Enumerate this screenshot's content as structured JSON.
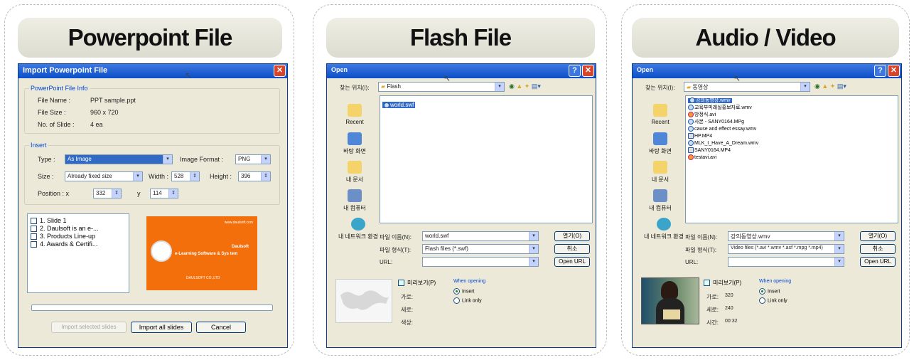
{
  "panels": {
    "ppt": {
      "title": "Powerpoint File"
    },
    "flash": {
      "title": "Flash File"
    },
    "av": {
      "title": "Audio / Video"
    }
  },
  "ppt_dialog": {
    "title": "Import Powerpoint File",
    "info_group": "PowerPoint File Info",
    "file_name_label": "File Name :",
    "file_name": "PPT sample.ppt",
    "file_size_label": "File Size :",
    "file_size": "960 x 720",
    "slides_label": "No. of Slide :",
    "slides": "4 ea",
    "insert_group": "Insert",
    "type_label": "Type :",
    "type_value": "As Image",
    "format_label": "Image Format :",
    "format_value": "PNG",
    "size_label": "Size :",
    "size_value": "Already fixed size",
    "width_label": "Width :",
    "width_value": "528",
    "height_label": "Height :",
    "height_value": "396",
    "position_label": "Position : x",
    "pos_x": "332",
    "y_label": "y",
    "pos_y": "114",
    "slides_list": [
      "1. Slide 1",
      "2. Daulsoft is an e-...",
      "3. Products Line-up",
      "4. Awards & Certifi..."
    ],
    "preview": {
      "brand": "Daulsoft",
      "line1": "e-Learning Software & Sys tem",
      "tag": "DAULSOFT CO.,LTD",
      "small": "www.daulsoft.com"
    },
    "btn_import_selected": "Import selected slides",
    "btn_import_all": "Import all slides",
    "btn_cancel": "Cancel"
  },
  "flash_dialog": {
    "title": "Open",
    "lookin_label": "찾는 위치(I):",
    "lookin_value": "Flash",
    "places": [
      "Recent",
      "바탕 화면",
      "내 문서",
      "내 컴퓨터",
      "내 네트워크 환경"
    ],
    "files": [
      "world.swf"
    ],
    "filename_label": "파일 이름(N):",
    "filename_value": "world.swf",
    "filetype_label": "파일 형식(T):",
    "filetype_value": "Flash files (*.swf)",
    "url_label": "URL:",
    "url_value": "",
    "btn_open": "열기(O)",
    "btn_cancel": "취소",
    "btn_openurl": "Open URL",
    "preview_check": "미리보기(P)",
    "width_label": "가로:",
    "width_value": "",
    "height_label": "세로:",
    "height_value": "",
    "color_label": "색상:",
    "color_value": "",
    "when_opening": "When opening",
    "opt_insert": "Insert",
    "opt_link": "Link only"
  },
  "av_dialog": {
    "title": "Open",
    "lookin_label": "찾는 위치(I):",
    "lookin_value": "동영상",
    "places": [
      "Recent",
      "바탕 화면",
      "내 문서",
      "내 컴퓨터",
      "내 네트워크 환경"
    ],
    "files": [
      "강의동영상.wmv",
      "교육부미래실홍보자료.wmv",
      "방정식.avi",
      "사본 - SANY0164.MPg",
      "cause and effect essay.wmv",
      "HP.MP4",
      "MLK_I_Have_A_Dream.wmv",
      "SANY0164.MP4",
      "testavi.avi"
    ],
    "filename_label": "파일 이름(N):",
    "filename_value": "강의동영상.wmv",
    "filetype_label": "파일 형식(T):",
    "filetype_value": "Video files (*.avi *.wmv *.asf *.mpg *.mp4)",
    "url_label": "URL:",
    "url_value": "",
    "btn_open": "열기(O)",
    "btn_cancel": "취소",
    "btn_openurl": "Open URL",
    "preview_check": "미리보기(P)",
    "width_label": "가로:",
    "width_value": "320",
    "height_label": "세로:",
    "height_value": "240",
    "time_label": "시간:",
    "time_value": "00:32",
    "when_opening": "When opening",
    "opt_insert": "Insert",
    "opt_link": "Link only"
  },
  "colors": {
    "titlebar": "#0b4fc8",
    "dialog_bg": "#ece9d8",
    "selection": "#316ac5",
    "ppt_orange": "#f36f0c"
  }
}
